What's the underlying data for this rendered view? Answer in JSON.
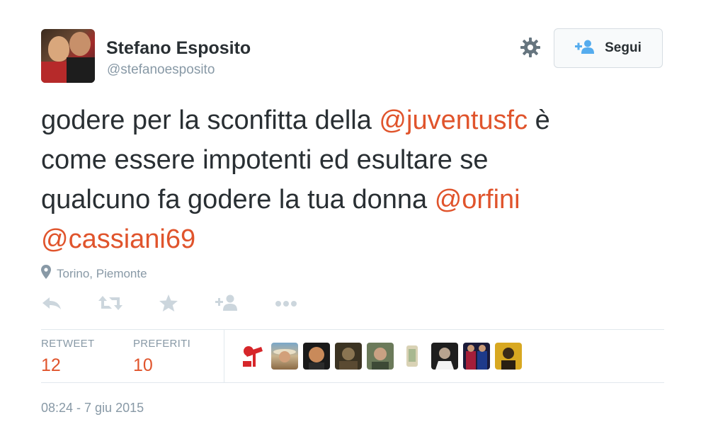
{
  "author": {
    "name": "Stefano Esposito",
    "handle": "@stefanoesposito"
  },
  "follow_button": {
    "label": "Segui",
    "icon": "add-user-icon"
  },
  "settings_icon": "gear-icon",
  "tweet": {
    "line1_pre": "godere per la sconfitta della ",
    "mention1": "@juventusfc",
    "line1_post": " è",
    "line2": "come essere impotenti ed esultare se",
    "line3_pre": "qualcuno fa godere la tua donna ",
    "mention2": "@orfini",
    "mention3": "@cassiani69"
  },
  "location": {
    "icon": "map-pin-icon",
    "text": "Torino, Piemonte"
  },
  "actions": [
    {
      "name": "reply",
      "icon": "reply-icon"
    },
    {
      "name": "retweet",
      "icon": "retweet-icon"
    },
    {
      "name": "favorite",
      "icon": "star-icon"
    },
    {
      "name": "follow",
      "icon": "add-user-icon"
    },
    {
      "name": "more",
      "icon": "more-icon"
    }
  ],
  "stats": {
    "retweet_label": "RETWEET",
    "retweet_count": "12",
    "favorites_label": "PREFERITI",
    "favorites_count": "10"
  },
  "colors": {
    "mention": "#e0542c",
    "text": "#292f33",
    "muted": "#8899a6",
    "icon": "#ccd6dd"
  },
  "timestamp": "08:24 - 7 giu 2015"
}
